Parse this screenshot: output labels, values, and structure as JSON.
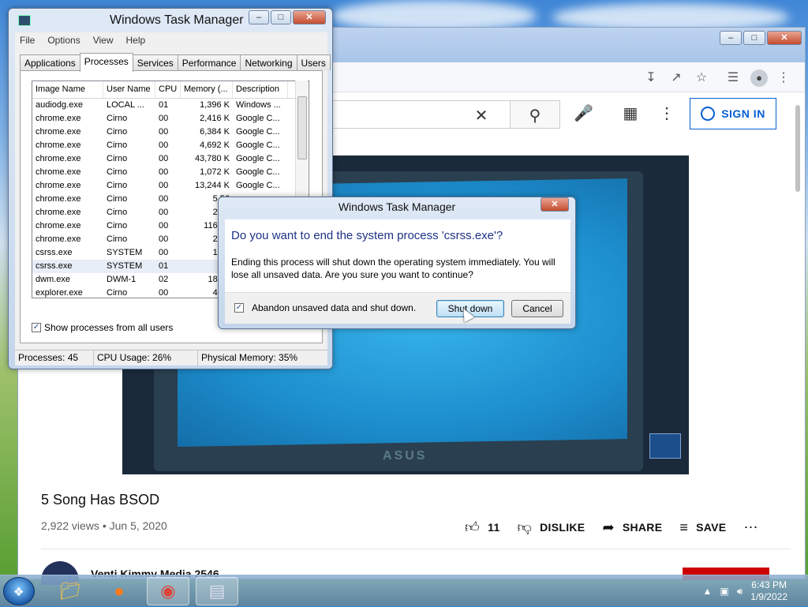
{
  "taskmgr": {
    "title": "Windows Task Manager",
    "menu": [
      "File",
      "Options",
      "View",
      "Help"
    ],
    "tabs": [
      "Applications",
      "Processes",
      "Services",
      "Performance",
      "Networking",
      "Users"
    ],
    "columns": [
      "Image Name",
      "User Name",
      "CPU",
      "Memory (...",
      "Description"
    ],
    "rows": [
      [
        "audiodg.exe",
        "LOCAL ...",
        "01",
        "1,396 K",
        "Windows ..."
      ],
      [
        "chrome.exe",
        "Cirno",
        "00",
        "2,416 K",
        "Google C..."
      ],
      [
        "chrome.exe",
        "Cirno",
        "00",
        "6,384 K",
        "Google C..."
      ],
      [
        "chrome.exe",
        "Cirno",
        "00",
        "4,692 K",
        "Google C..."
      ],
      [
        "chrome.exe",
        "Cirno",
        "00",
        "43,780 K",
        "Google C..."
      ],
      [
        "chrome.exe",
        "Cirno",
        "00",
        "1,072 K",
        "Google C..."
      ],
      [
        "chrome.exe",
        "Cirno",
        "00",
        "13,244 K",
        "Google C..."
      ],
      [
        "chrome.exe",
        "Cirno",
        "00",
        "5,56",
        ""
      ],
      [
        "chrome.exe",
        "Cirno",
        "00",
        "2,12",
        ""
      ],
      [
        "chrome.exe",
        "Cirno",
        "00",
        "116,78",
        ""
      ],
      [
        "chrome.exe",
        "Cirno",
        "00",
        "2,07",
        ""
      ],
      [
        "csrss.exe",
        "SYSTEM",
        "00",
        "1,02",
        ""
      ],
      [
        "csrss.exe",
        "SYSTEM",
        "01",
        "90",
        ""
      ],
      [
        "dwm.exe",
        "DWM-1",
        "02",
        "18,04",
        ""
      ],
      [
        "explorer.exe",
        "Cirno",
        "00",
        "4,75",
        ""
      ]
    ],
    "show_all_label": "Show processes from all users",
    "status": {
      "processes": "Processes: 45",
      "cpu": "CPU Usage: 26%",
      "memory": "Physical Memory: 35%"
    }
  },
  "dialog": {
    "title": "Windows Task Manager",
    "question": "Do you want to end the system process 'csrss.exe'?",
    "text": "Ending this process will shut down the operating system immediately.  You will lose all unsaved data.  Are you sure you want to continue?",
    "checkbox_label": "Abandon unsaved data and shut down.",
    "shutdown_label": "Shut down",
    "cancel_label": "Cancel"
  },
  "youtube": {
    "sign_in": "SIGN IN",
    "video_title": "5 Song Has BSOD",
    "meta": "2,922 views • Jun 5, 2020",
    "likes": "11",
    "dislike": "DISLIKE",
    "share": "SHARE",
    "save": "SAVE",
    "channel": "Venti Kimmy Media 2546",
    "screen_brand": "ASUS"
  },
  "taskbar": {
    "time": "6:43 PM",
    "date": "1/9/2022"
  },
  "colors": {
    "accent": "#065fd4",
    "dialog_question": "#1e3287"
  }
}
